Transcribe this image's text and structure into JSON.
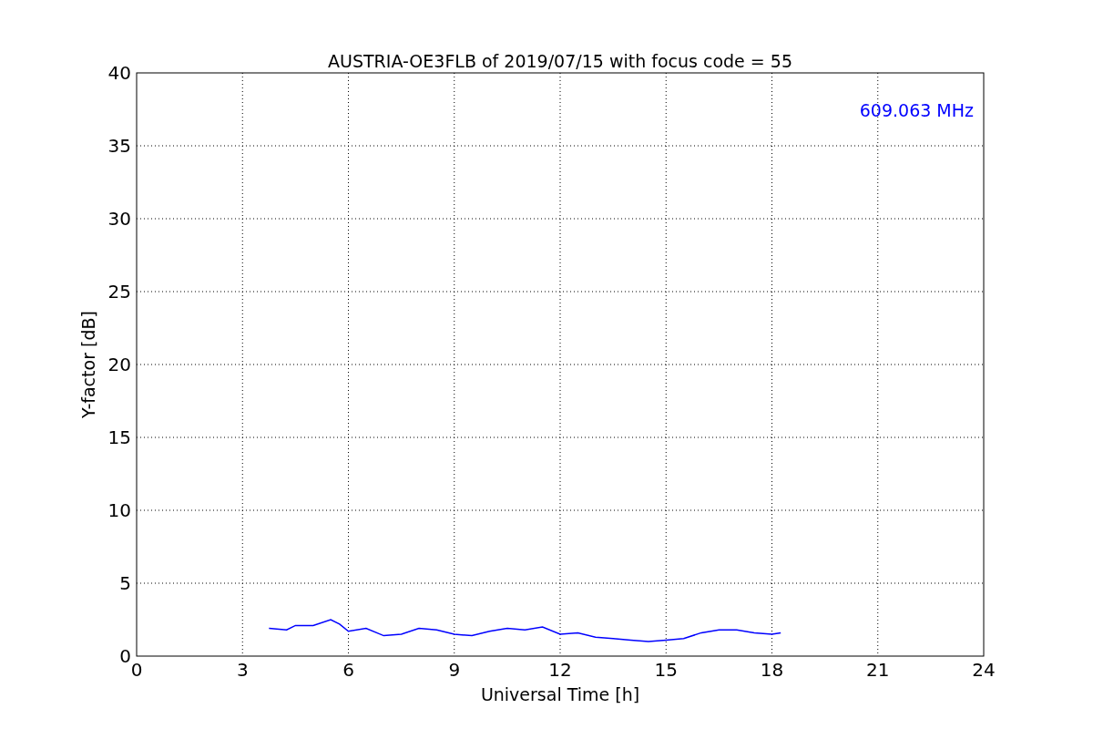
{
  "figure": {
    "chart_data": {
      "type": "line",
      "title": "AUSTRIA-OE3FLB of 2019/07/15 with focus code = 55",
      "xlabel": "Universal Time [h]",
      "ylabel": "Y-factor [dB]",
      "x": [
        3.75,
        4.25,
        4.5,
        5,
        5.5,
        5.75,
        6,
        6.5,
        7,
        7.5,
        8,
        8.5,
        9,
        9.5,
        10,
        10.5,
        11,
        11.5,
        12,
        12.5,
        13,
        13.5,
        14,
        14.5,
        15,
        15.5,
        16,
        16.5,
        17,
        17.5,
        18,
        18.25
      ],
      "series": [
        {
          "name": "609.063 MHz",
          "color": "#0000ff",
          "values": [
            1.9,
            1.8,
            2.1,
            2.1,
            2.5,
            2.2,
            1.7,
            1.9,
            1.4,
            1.5,
            1.9,
            1.8,
            1.5,
            1.4,
            1.7,
            1.9,
            1.8,
            2.0,
            1.5,
            1.6,
            1.3,
            1.2,
            1.1,
            1.0,
            1.1,
            1.2,
            1.6,
            1.8,
            1.8,
            1.6,
            1.5,
            1.6
          ]
        }
      ],
      "xlim": [
        0,
        24
      ],
      "ylim": [
        0,
        40
      ],
      "xticks": [
        0,
        3,
        6,
        9,
        12,
        15,
        18,
        21,
        24
      ],
      "yticks": [
        0,
        5,
        10,
        15,
        20,
        25,
        30,
        35,
        40
      ],
      "grid": true
    }
  }
}
